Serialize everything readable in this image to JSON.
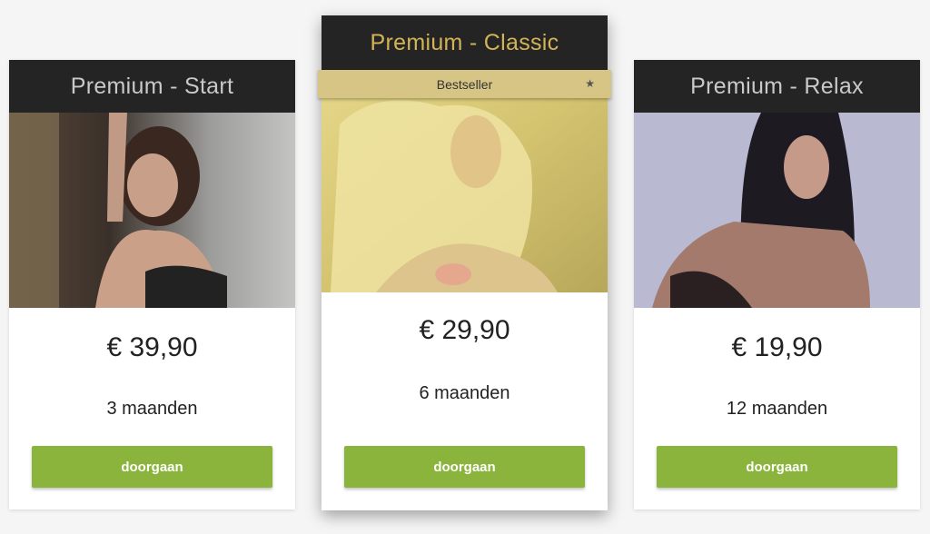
{
  "plans": [
    {
      "title": "Premium - Start",
      "price": "€ 39,90",
      "duration": "3 maanden",
      "button_label": "doorgaan"
    },
    {
      "title": "Premium - Classic",
      "badge": "Bestseller",
      "price": "€ 29,90",
      "duration": "6 maanden",
      "button_label": "doorgaan"
    },
    {
      "title": "Premium - Relax",
      "price": "€ 19,90",
      "duration": "12 maanden",
      "button_label": "doorgaan"
    }
  ],
  "colors": {
    "header_bg": "#242424",
    "featured_title": "#d2b456",
    "ribbon_bg": "#d6c585",
    "button_bg": "#8ab43c"
  },
  "icons": [
    "star-icon"
  ]
}
